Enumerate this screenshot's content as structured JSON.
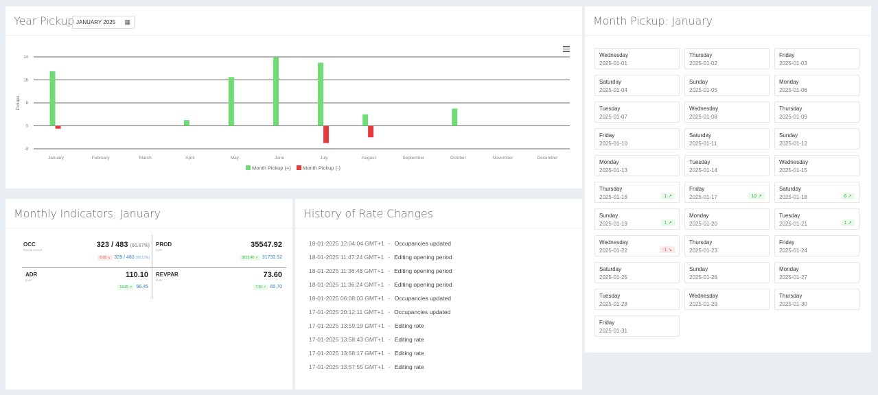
{
  "year_pickup": {
    "title": "Year Pickup",
    "date_value": "JANUARY 2025",
    "calendar_icon": "calendar-icon",
    "menu_icon": "hamburger-menu-icon"
  },
  "chart_data": {
    "type": "bar",
    "categories": [
      "January",
      "February",
      "March",
      "April",
      "May",
      "June",
      "July",
      "August",
      "September",
      "October",
      "November",
      "December"
    ],
    "series": [
      {
        "name": "Month Pickup (+)",
        "color": "#6fdc75",
        "values": [
          19,
          0,
          0,
          2,
          17,
          24,
          22,
          4,
          0,
          6,
          0,
          0
        ]
      },
      {
        "name": "Month Pickup (-)",
        "color": "#e63b3b",
        "values": [
          -1,
          0,
          0,
          0,
          0,
          0,
          -6,
          -4,
          0,
          0,
          0,
          0
        ]
      }
    ],
    "ylabel": "Pickups",
    "yticks": [
      24,
      16,
      8,
      0,
      -8
    ],
    "ylim": [
      -8,
      24
    ],
    "grid": true,
    "legend": "bottom"
  },
  "month_pickup": {
    "title": "Month Pickup: January",
    "days": [
      {
        "name": "Wednesday",
        "date": "2025-01-01",
        "badge": ""
      },
      {
        "name": "Thursday",
        "date": "2025-01-02",
        "badge": ""
      },
      {
        "name": "Friday",
        "date": "2025-01-03",
        "badge": ""
      },
      {
        "name": "Saturday",
        "date": "2025-01-04",
        "badge": ""
      },
      {
        "name": "Sunday",
        "date": "2025-01-05",
        "badge": ""
      },
      {
        "name": "Monday",
        "date": "2025-01-06",
        "badge": ""
      },
      {
        "name": "Tuesday",
        "date": "2025-01-07",
        "badge": ""
      },
      {
        "name": "Wednesday",
        "date": "2025-01-08",
        "badge": ""
      },
      {
        "name": "Thursday",
        "date": "2025-01-09",
        "badge": ""
      },
      {
        "name": "Friday",
        "date": "2025-01-10",
        "badge": ""
      },
      {
        "name": "Saturday",
        "date": "2025-01-11",
        "badge": ""
      },
      {
        "name": "Sunday",
        "date": "2025-01-12",
        "badge": ""
      },
      {
        "name": "Monday",
        "date": "2025-01-13",
        "badge": ""
      },
      {
        "name": "Tuesday",
        "date": "2025-01-14",
        "badge": ""
      },
      {
        "name": "Wednesday",
        "date": "2025-01-15",
        "badge": ""
      },
      {
        "name": "Thursday",
        "date": "2025-01-16",
        "badge": "1 ↗",
        "dir": "pos"
      },
      {
        "name": "Friday",
        "date": "2025-01-17",
        "badge": "10 ↗",
        "dir": "pos"
      },
      {
        "name": "Saturday",
        "date": "2025-01-18",
        "badge": "6 ↗",
        "dir": "pos"
      },
      {
        "name": "Sunday",
        "date": "2025-01-19",
        "badge": "1 ↗",
        "dir": "pos"
      },
      {
        "name": "Monday",
        "date": "2025-01-20",
        "badge": ""
      },
      {
        "name": "Tuesday",
        "date": "2025-01-21",
        "badge": "1 ↗",
        "dir": "pos"
      },
      {
        "name": "Wednesday",
        "date": "2025-01-22",
        "badge": "-1 ↘",
        "dir": "neg"
      },
      {
        "name": "Thursday",
        "date": "2025-01-23",
        "badge": ""
      },
      {
        "name": "Friday",
        "date": "2025-01-24",
        "badge": ""
      },
      {
        "name": "Saturday",
        "date": "2025-01-25",
        "badge": ""
      },
      {
        "name": "Sunday",
        "date": "2025-01-26",
        "badge": ""
      },
      {
        "name": "Monday",
        "date": "2025-01-27",
        "badge": ""
      },
      {
        "name": "Tuesday",
        "date": "2025-01-28",
        "badge": ""
      },
      {
        "name": "Wednesday",
        "date": "2025-01-29",
        "badge": ""
      },
      {
        "name": "Thursday",
        "date": "2025-01-30",
        "badge": ""
      },
      {
        "name": "Friday",
        "date": "2025-01-31",
        "badge": ""
      }
    ]
  },
  "indicators": {
    "title": "Monthly Indicators: January",
    "occ": {
      "label": "OCC",
      "sub": "ROOM NIGHT",
      "value": "323 / 483",
      "pct": "(66.87%)",
      "chip": "6.00 ↘",
      "prev": "329 / 483",
      "prev_pct": "(68.12%)"
    },
    "prod": {
      "label": "PROD",
      "sub": "EUR",
      "value": "35547.92",
      "chip": "3815.40 ↗",
      "prev": "31732.52"
    },
    "adr": {
      "label": "ADR",
      "sub": "EUR",
      "value": "110.10",
      "chip": "13.65 ↗",
      "prev": "96.45"
    },
    "revpar": {
      "label": "REVPAR",
      "sub": "EUR",
      "value": "73.60",
      "chip": "7.90 ↗",
      "prev": "65.70"
    }
  },
  "history": {
    "title": "History of Rate Changes",
    "rows": [
      {
        "time": "18-01-2025 12:04:04 GMT+1",
        "action": "Occupancies updated"
      },
      {
        "time": "18-01-2025 11:47:24 GMT+1",
        "action": "Editing opening period"
      },
      {
        "time": "18-01-2025 11:36:48 GMT+1",
        "action": "Editing opening period"
      },
      {
        "time": "18-01-2025 11:36:24 GMT+1",
        "action": "Editing opening period"
      },
      {
        "time": "18-01-2025 06:08:03 GMT+1",
        "action": "Occupancies updated"
      },
      {
        "time": "17-01-2025 20:12:11 GMT+1",
        "action": "Occupancies updated"
      },
      {
        "time": "17-01-2025 13:59:19 GMT+1",
        "action": "Editing rate"
      },
      {
        "time": "17-01-2025 13:58:43 GMT+1",
        "action": "Editing rate"
      },
      {
        "time": "17-01-2025 13:58:17 GMT+1",
        "action": "Editing rate"
      },
      {
        "time": "17-01-2025 13:57:55 GMT+1",
        "action": "Editing rate"
      }
    ],
    "separator": "-"
  }
}
